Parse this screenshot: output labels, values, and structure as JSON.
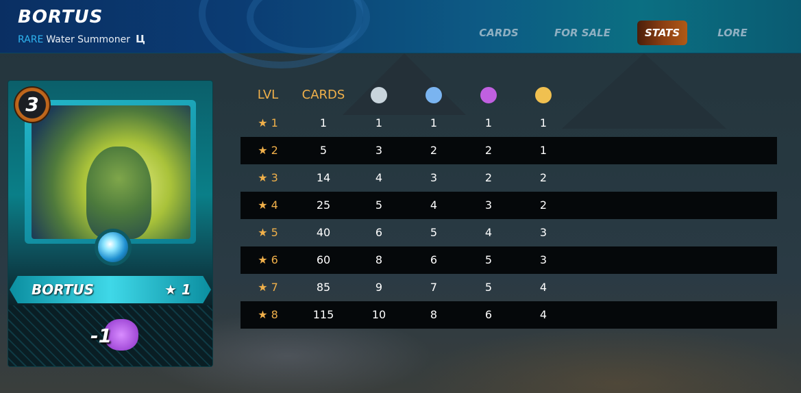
{
  "header": {
    "title": "BORTUS",
    "rarity": "RARE",
    "subtitle": "Water Summoner",
    "edition_mark": "Ц"
  },
  "tabs": [
    {
      "label": "CARDS",
      "active": false
    },
    {
      "label": "FOR SALE",
      "active": false
    },
    {
      "label": "STATS",
      "active": true
    },
    {
      "label": "LORE",
      "active": false
    }
  ],
  "card": {
    "mana": "3",
    "name": "BORTUS",
    "level": "★ 1",
    "ability": "-1"
  },
  "stats": {
    "headers": {
      "lvl": "LVL",
      "cards": "CARDS"
    },
    "dot_colors": [
      "#c8d4dc",
      "#7ab4f0",
      "#c060e0",
      "#f0c050"
    ],
    "rows": [
      [
        "★ 1",
        "1",
        "1",
        "1",
        "1",
        "1"
      ],
      [
        "★ 2",
        "5",
        "3",
        "2",
        "2",
        "1"
      ],
      [
        "★ 3",
        "14",
        "4",
        "3",
        "2",
        "2"
      ],
      [
        "★ 4",
        "25",
        "5",
        "4",
        "3",
        "2"
      ],
      [
        "★ 5",
        "40",
        "6",
        "5",
        "4",
        "3"
      ],
      [
        "★ 6",
        "60",
        "8",
        "6",
        "5",
        "3"
      ],
      [
        "★ 7",
        "85",
        "9",
        "7",
        "5",
        "4"
      ],
      [
        "★ 8",
        "115",
        "10",
        "8",
        "6",
        "4"
      ]
    ]
  }
}
